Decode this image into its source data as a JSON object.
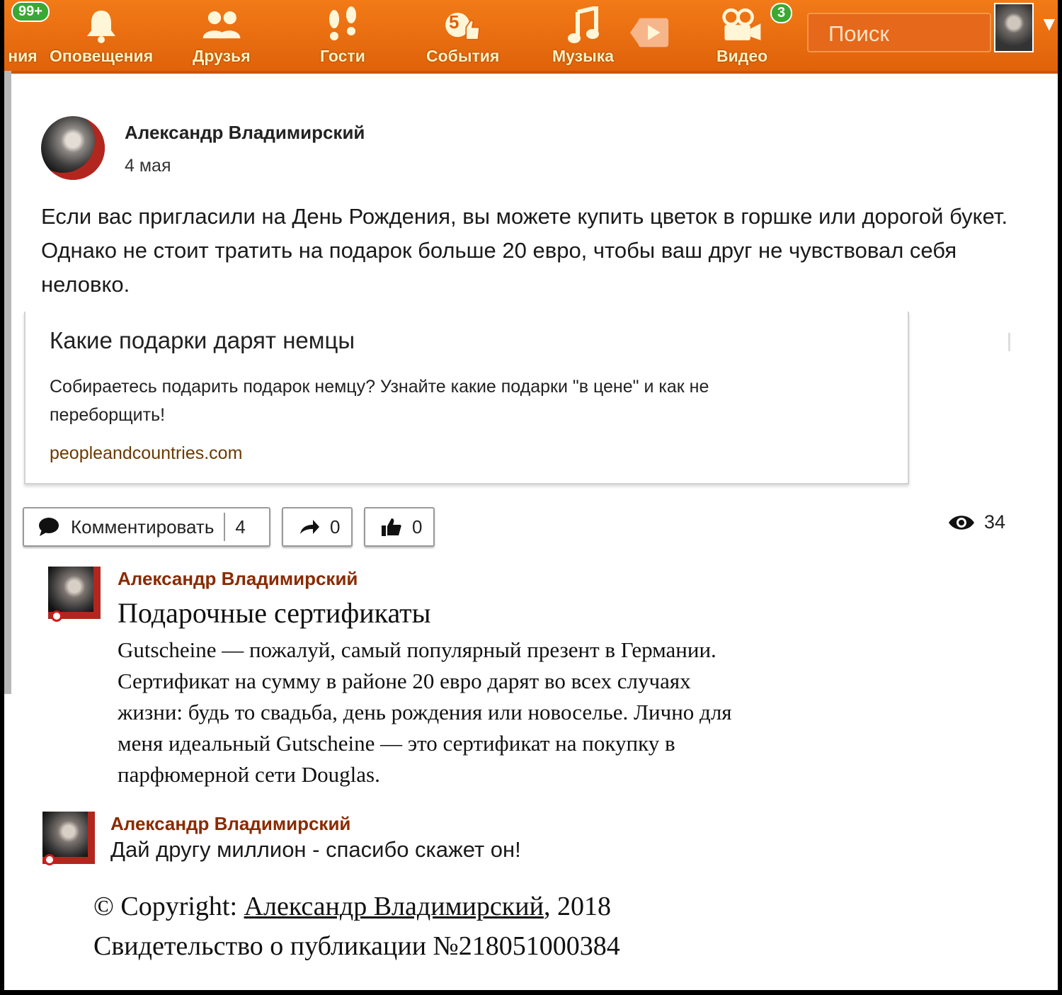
{
  "nav": {
    "items": [
      {
        "label": "ния",
        "icon": "messages-icon"
      },
      {
        "label": "Оповещения",
        "icon": "bell-icon"
      },
      {
        "label": "Друзья",
        "icon": "friends-icon"
      },
      {
        "label": "Гости",
        "icon": "footprints-icon"
      },
      {
        "label": "События",
        "icon": "thumbs-up-icon"
      },
      {
        "label": "Музыка",
        "icon": "music-note-icon"
      },
      {
        "label": "",
        "icon": "play-icon"
      },
      {
        "label": "Видео",
        "icon": "video-camera-icon"
      }
    ],
    "badge_messages": "99+",
    "badge_events": "5",
    "badge_video": "3",
    "search_placeholder": "Поиск"
  },
  "post": {
    "author": "Александр Владимирский",
    "date": "4 мая",
    "text": "Если вас пригласили на День Рождения, вы можете купить цветок в горшке или дорогой букет. Однако не стоит тратить на подарок больше 20 евро, чтобы ваш друг не чувствовал себя неловко.",
    "link": {
      "title": "Какие подарки дарят немцы",
      "description": "Собираетесь подарить подарок немцу? Узнайте какие подарки \"в цене\" и как не переборщить!",
      "domain": "peopleandcountries.com"
    },
    "actions": {
      "comment_label": "Комментировать",
      "comment_count": "4",
      "share_count": "0",
      "like_count": "0",
      "views": "34"
    }
  },
  "comments": [
    {
      "author": "Александр Владимирский",
      "title": "Подарочные сертификаты",
      "text": "Gutscheine — пожалуй, самый популярный презент в Германии. Сертификат на сумму в районе 20 евро дарят во всех случаях жизни: будь то свадьба, день рождения или новоселье. Лично для меня идеальный Gutscheine — это сертификат на покупку в парфюмерной сети Douglas."
    },
    {
      "author": "Александр Владимирский",
      "text": "Дай другу миллион - спасибо скажет он!"
    }
  ],
  "footer": {
    "copyright_prefix": "© Copyright: ",
    "copyright_author": "Александр Владимирский",
    "copyright_year": ", 2018",
    "certificate": "Свидетельство о публикации №218051000384"
  },
  "colors": {
    "brand_orange": "#ee7011",
    "badge_green": "#3aa832",
    "comment_author": "#8a2a00"
  }
}
